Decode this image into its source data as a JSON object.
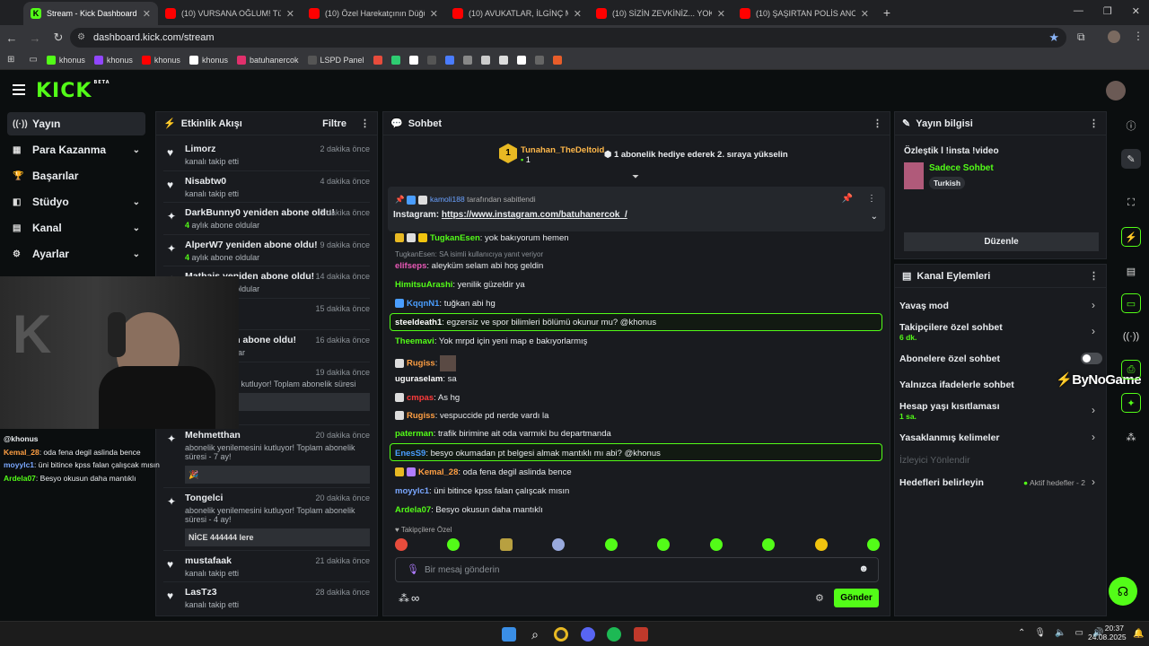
{
  "browser": {
    "tabs": [
      {
        "title": "Stream - Kick Dashboard",
        "icon": "kick-icon",
        "active": true
      },
      {
        "title": "(10) VURSANA OĞLUM! Türkiye",
        "icon": "youtube-icon"
      },
      {
        "title": "(10) Özel Harekatçının Düğün K",
        "icon": "youtube-icon"
      },
      {
        "title": "(10) AVUKATLAR, İLGİNÇ MAHK",
        "icon": "youtube-icon"
      },
      {
        "title": "(10) SİZİN ZEVKİNİZ... YOK! - Yo",
        "icon": "youtube-icon"
      },
      {
        "title": "(10) ŞAŞIRTAN POLİS ANONSU",
        "icon": "youtube-icon"
      }
    ],
    "new_tab": "+",
    "url": "dashboard.kick.com/stream",
    "bookmarks": [
      {
        "label": "khonus",
        "color": "#53fc18"
      },
      {
        "label": "khonus",
        "color": "#9146ff"
      },
      {
        "label": "khonus",
        "color": "#ff0000"
      },
      {
        "label": "khonus",
        "color": "#ffffff"
      },
      {
        "label": "batuhanercok",
        "color": "#e1306c"
      },
      {
        "label": "LSPD Panel",
        "color": "#333333"
      }
    ]
  },
  "kick": {
    "logo": "KICK",
    "logo_beta": "BETA",
    "sidebar": [
      {
        "label": "Yayın",
        "icon": "broadcast-icon",
        "active": true,
        "chevron": false
      },
      {
        "label": "Para Kazanma",
        "icon": "money-icon",
        "chevron": true
      },
      {
        "label": "Başarılar",
        "icon": "trophy-icon",
        "chevron": false
      },
      {
        "label": "Stüdyo",
        "icon": "studio-icon",
        "chevron": true
      },
      {
        "label": "Kanal",
        "icon": "channel-icon",
        "chevron": true
      },
      {
        "label": "Ayarlar",
        "icon": "settings-icon",
        "chevron": true
      }
    ],
    "activity": {
      "title": "Etkinlik Akışı",
      "filter": "Filtre",
      "items": [
        {
          "name": "Limorz",
          "sub": "kanalı takip etti",
          "time": "2 dakika önce",
          "icon": "heart-icon"
        },
        {
          "name": "Nisabtw0",
          "sub": "kanalı takip etti",
          "time": "4 dakika önce",
          "icon": "heart-icon"
        },
        {
          "name": "DarkBunny0 yeniden abone oldu!",
          "months": "4",
          "sub": "aylık abone oldular",
          "time": "7 dakika önce",
          "icon": "star-icon"
        },
        {
          "name": "AlperW7 yeniden abone oldu!",
          "months": "4",
          "sub": "aylık abone oldular",
          "time": "9 dakika önce",
          "icon": "star-icon"
        },
        {
          "name": "Mathais yeniden abone oldu!",
          "months": "4",
          "sub": "aylık abone oldular",
          "time": "14 dakika önce",
          "icon": "star-icon"
        },
        {
          "name": "",
          "sub": "",
          "time": "15 dakika önce",
          "icon": "star-icon"
        },
        {
          "name": "iden abone oldu!",
          "sub": "oldular",
          "time": "16 dakika önce",
          "icon": "star-icon"
        },
        {
          "name": "",
          "sub": "mesini kutluyor! Toplam abonelik süresi",
          "time": "19 dakika önce",
          "icon": "star-icon"
        }
      ],
      "tall_items": [
        {
          "name": "Mehmetthan",
          "sub": "abonelik yenilemesini kutluyor! Toplam abonelik süresi - 7 ay!",
          "time": "20 dakika önce",
          "box": "🎉"
        },
        {
          "name": "Tongelci",
          "sub": "abonelik yenilemesini kutluyor! Toplam abonelik süresi - 4 ay!",
          "time": "20 dakika önce",
          "box": "NİCE 444444 lere"
        }
      ],
      "follows": [
        {
          "name": "mustafaak",
          "sub": "kanalı takip etti",
          "time": "21 dakika önce"
        },
        {
          "name": "LasTz3",
          "sub": "kanalı takip etti",
          "time": "28 dakika önce"
        }
      ]
    },
    "webcam_overlay": {
      "handle": "@khonus",
      "lines": [
        {
          "user": "Kemal_28",
          "text": ": oda fena degil aslinda bence",
          "color": "#ff9f43"
        },
        {
          "user": "moyylc1",
          "text": ": üni bitince kpss falan çalışcak mısın",
          "color": "#7aa7ff"
        },
        {
          "user": "Ardela07",
          "text": ": Besyo okusun daha mantıklı",
          "color": "#53fc18"
        }
      ]
    },
    "chat": {
      "title": "Sohbet",
      "gift_user": "Tunahan_TheDeltoid",
      "gift_count": "1",
      "gift_rank": "1",
      "gift_text": "1 abonelik hediye ederek 2. sıraya yükselin",
      "pinned_by": "kamoli188",
      "pinned_by_suffix": "tarafından sabitlendi",
      "pinned_label": "Instagram:",
      "pinned_link": "https://www.instagram.com/batuhanercok_/",
      "messages": [
        {
          "user": "TugkanEsen",
          "color": "#53fc18",
          "text": ": yok bakıyorum hemen"
        },
        {
          "reply": "TugkanEsen: SA isimli kullanıcıya yanıt veriyor",
          "user": "elifseps",
          "color": "#e858b6",
          "text": ": aleyküm selam abi hoş geldin"
        },
        {
          "user": "HimitsuArashi",
          "color": "#53fc18",
          "text": ": yenilik güzeldir ya"
        },
        {
          "user": "KqqnN1",
          "color": "#4a9eff",
          "text": ": tuğkan abi hg"
        },
        {
          "user": "steeldeath1",
          "color": "#ffffff",
          "text": ": egzersiz ve spor bilimleri bölümü okunur mu? @khonus",
          "highlight": true
        },
        {
          "user": "Theemavi",
          "color": "#53fc18",
          "text": ": Yok mrpd için yeni map e bakıyorlarmış"
        },
        {
          "user": "Rugiss",
          "color": "#ff9f43",
          "text": ":"
        },
        {
          "user": "uguraselam",
          "color": "#ffffff",
          "text": ": sa"
        },
        {
          "user": "cmpas",
          "color": "#ff3b3b",
          "text": ": As hg"
        },
        {
          "user": "Rugiss",
          "color": "#ff9f43",
          "text": ": vespuccide pd nerde vardı la"
        },
        {
          "user": "paterman",
          "color": "#53fc18",
          "text": ": trafik birimine ait oda varmıki bu departmanda"
        },
        {
          "user": "EnesS9",
          "color": "#4a9eff",
          "text": ": besyo okumadan pt belgesi almak mantıklı mı abi? @khonus",
          "highlight": true
        },
        {
          "user": "Kemal_28",
          "color": "#ff9f43",
          "text": ": oda fena degil aslinda bence"
        },
        {
          "user": "moyylc1",
          "color": "#7aa7ff",
          "text": ": üni bitince kpss falan çalışcak mısın"
        },
        {
          "user": "Ardela07",
          "color": "#53fc18",
          "text": ": Besyo okusun daha mantıklı"
        }
      ],
      "followers_only": "Takipçilere Özel",
      "input_placeholder": "Bir mesaj gönderin",
      "send": "Gönder"
    },
    "stream_info": {
      "title": "Yayın bilgisi",
      "stream_title": "Özleştik l !insta !video",
      "category": "Sadece Sohbet",
      "tag": "Turkish",
      "edit": "Düzenle"
    },
    "channel_actions": {
      "title": "Kanal Eylemleri",
      "items": [
        {
          "label": "Yavaş mod",
          "sub": "",
          "control": "chevron"
        },
        {
          "label": "Takipçilere özel sohbet",
          "sub": "6 dk.",
          "control": "chevron"
        },
        {
          "label": "Abonelere özel sohbet",
          "sub": "",
          "control": "toggle"
        },
        {
          "label": "Yalnızca ifadelerle sohbet",
          "sub": "",
          "control": "toggle"
        },
        {
          "label": "Hesap yaşı kısıtlaması",
          "sub": "1 sa.",
          "control": "chevron"
        },
        {
          "label": "Yasaklanmış kelimeler",
          "sub": "",
          "control": "chevron"
        },
        {
          "label": "İzleyici Yönlendir",
          "sub": "",
          "control": "none",
          "disabled": true
        },
        {
          "label": "Hedefleri belirleyin",
          "sub": "",
          "control": "chevron",
          "status": "Aktif hedefler - 2"
        }
      ]
    },
    "watermark": "ByNoGame"
  },
  "taskbar": {
    "time": "20:37",
    "date": "24.08.2025"
  }
}
